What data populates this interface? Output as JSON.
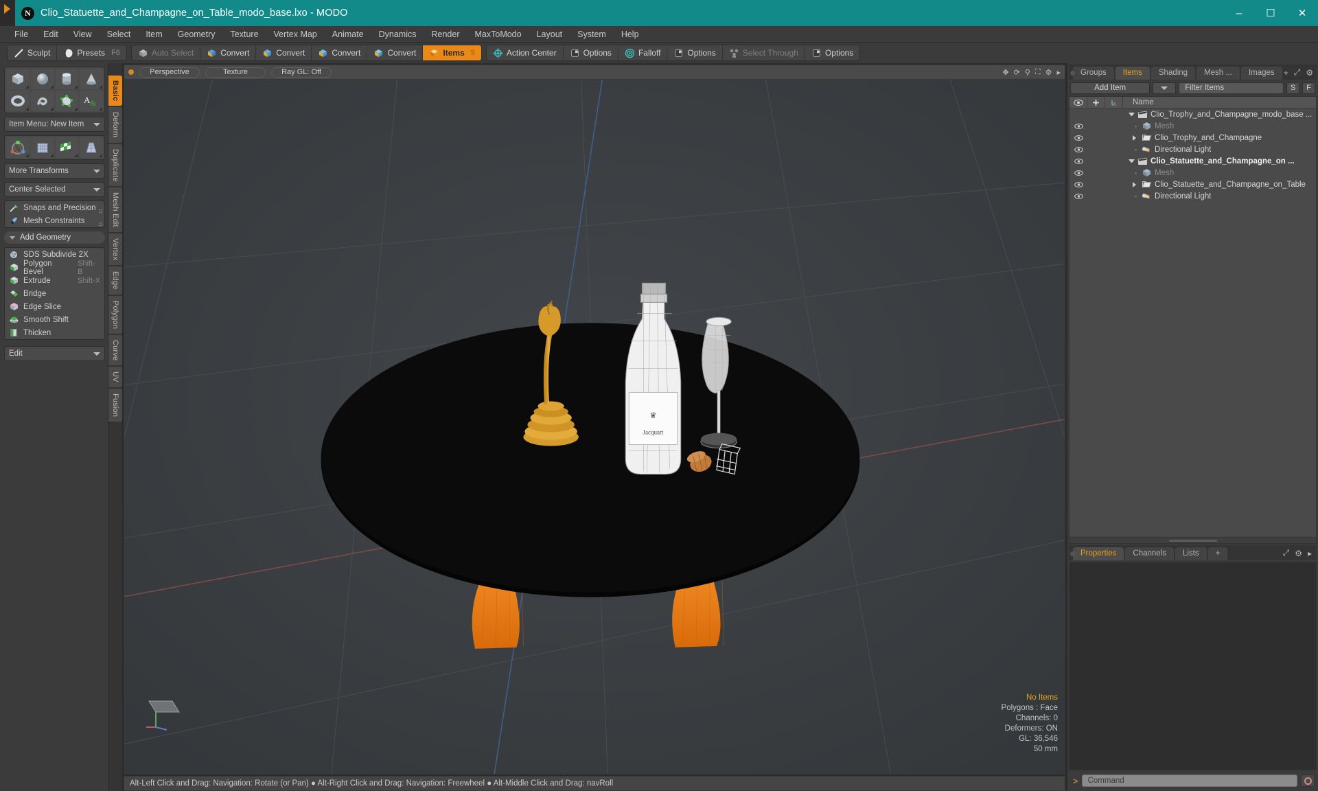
{
  "window": {
    "title": "Clio_Statuette_and_Champagne_on_Table_modo_base.lxo - MODO",
    "app_icon": "modo-logo-icon",
    "minimize": "–",
    "maximize": "☐",
    "close": "✕",
    "titlebar_color": "#128a8a"
  },
  "menubar": {
    "items": [
      "File",
      "Edit",
      "View",
      "Select",
      "Item",
      "Geometry",
      "Texture",
      "Vertex Map",
      "Animate",
      "Dynamics",
      "Render",
      "MaxToModo",
      "Layout",
      "System",
      "Help"
    ]
  },
  "modebar": {
    "groups": [
      {
        "buttons": [
          {
            "label": "Sculpt",
            "icon": "sculpt-pen-icon",
            "state": "normal",
            "shortcut": ""
          },
          {
            "label": "Presets",
            "icon": "presets-sphere-icon",
            "state": "normal",
            "shortcut": "F6"
          }
        ]
      },
      {
        "buttons": [
          {
            "label": "Auto Select",
            "icon": "cube-grey-icon",
            "state": "disabled",
            "shortcut": ""
          },
          {
            "label": "Convert",
            "icon": "convert-vertex-icon",
            "state": "normal",
            "shortcut": ""
          },
          {
            "label": "Convert",
            "icon": "convert-edge-icon",
            "state": "normal",
            "shortcut": ""
          },
          {
            "label": "Convert",
            "icon": "convert-polygon-icon",
            "state": "normal",
            "shortcut": ""
          },
          {
            "label": "Convert",
            "icon": "convert-material-icon",
            "state": "normal",
            "shortcut": ""
          },
          {
            "label": "Items",
            "icon": "items-cube-icon",
            "state": "active",
            "shortcut": "5"
          }
        ]
      },
      {
        "buttons": [
          {
            "label": "Action Center",
            "icon": "action-center-icon",
            "state": "normal",
            "shortcut": ""
          },
          {
            "label": "Options",
            "icon": "options-box-icon",
            "state": "normal",
            "shortcut": ""
          },
          {
            "label": "Falloff",
            "icon": "falloff-target-icon",
            "state": "normal",
            "shortcut": ""
          },
          {
            "label": "Options",
            "icon": "options-box-icon",
            "state": "normal",
            "shortcut": ""
          },
          {
            "label": "Select Through",
            "icon": "select-through-icon",
            "state": "disabled",
            "shortcut": ""
          },
          {
            "label": "Options",
            "icon": "options-box-icon",
            "state": "normal",
            "shortcut": ""
          }
        ]
      }
    ]
  },
  "left_panel": {
    "primitive_tiles": [
      {
        "icon": "cube-primitive-icon"
      },
      {
        "icon": "sphere-primitive-icon"
      },
      {
        "icon": "cylinder-primitive-icon"
      },
      {
        "icon": "cone-primitive-icon"
      },
      {
        "icon": "torus-primitive-icon"
      },
      {
        "icon": "tube-primitive-icon"
      },
      {
        "icon": "polygon-pen-icon"
      },
      {
        "icon": "text-tool-icon"
      }
    ],
    "item_menu": {
      "label": "Item Menu: New Item"
    },
    "transform_tiles": [
      {
        "icon": "transform-gizmo-icon"
      },
      {
        "icon": "bend-grid-icon"
      },
      {
        "icon": "checker-plane-icon"
      },
      {
        "icon": "taper-grid-icon"
      }
    ],
    "more_transforms": {
      "label": "More Transforms"
    },
    "center_selected": {
      "label": "Center Selected"
    },
    "snaps_rows": [
      {
        "label": "Snaps and Precision",
        "icon": "snap-arrow-icon"
      },
      {
        "label": "Mesh Constraints",
        "icon": "mesh-constraint-icon"
      }
    ],
    "add_geometry_header": "Add Geometry",
    "geometry_rows": [
      {
        "label": "SDS Subdivide 2X",
        "icon": "sds-subdivide-icon",
        "shortcut": ""
      },
      {
        "label": "Polygon Bevel",
        "icon": "polygon-bevel-icon",
        "shortcut": "Shift-B"
      },
      {
        "label": "Extrude",
        "icon": "extrude-icon",
        "shortcut": "Shift-X"
      },
      {
        "label": "Bridge",
        "icon": "bridge-icon",
        "shortcut": ""
      },
      {
        "label": "Edge Slice",
        "icon": "edge-slice-icon",
        "shortcut": ""
      },
      {
        "label": "Smooth Shift",
        "icon": "smooth-shift-icon",
        "shortcut": ""
      },
      {
        "label": "Thicken",
        "icon": "thicken-icon",
        "shortcut": ""
      }
    ],
    "edit_dropdown": {
      "label": "Edit"
    }
  },
  "vertical_tabs": {
    "items": [
      {
        "label": "Basic",
        "active": true
      },
      {
        "label": "Deform",
        "active": false
      },
      {
        "label": "Duplicate",
        "active": false
      },
      {
        "label": "Mesh Edit",
        "active": false
      },
      {
        "label": "Vertex",
        "active": false
      },
      {
        "label": "Edge",
        "active": false
      },
      {
        "label": "Polygon",
        "active": false
      },
      {
        "label": "Curve",
        "active": false
      },
      {
        "label": "UV",
        "active": false
      },
      {
        "label": "Fusion",
        "active": false
      }
    ]
  },
  "viewport": {
    "header_buttons": [
      "Perspective",
      "Texture",
      "Ray GL: Off"
    ],
    "header_icons": [
      "move-view-icon",
      "rotate-view-icon",
      "zoom-view-icon",
      "fit-view-icon",
      "gear-icon",
      "chevron-right-icon"
    ],
    "stats": {
      "selection": "No Items",
      "polygons": "Polygons : Face",
      "channels": "Channels: 0",
      "deformers": "Deformers: ON",
      "gl": "GL: 36,546",
      "scale": "50 mm"
    },
    "axis_labels": [
      "x",
      "y",
      "z"
    ],
    "scene_description": "black elliptical table with orange legs holding a gold trophy statuette, a wireframe champagne bottle, a champagne flute, a cork and a wire cage"
  },
  "statusbar": {
    "text": "Alt-Left Click and Drag: Navigation: Rotate (or Pan) ● Alt-Right Click and Drag: Navigation: Freewheel ● Alt-Middle Click and Drag: navRoll"
  },
  "right_panel": {
    "top_tabs": [
      {
        "label": "Groups",
        "active": false
      },
      {
        "label": "Items",
        "active": true
      },
      {
        "label": "Shading",
        "active": false
      },
      {
        "label": "Mesh ...",
        "active": false
      },
      {
        "label": "Images",
        "active": false
      }
    ],
    "top_tab_icons": [
      "plus-icon",
      "expand-icon",
      "gear-icon",
      "chevron-right-icon"
    ],
    "add_item": {
      "label": "Add Item",
      "caret_icon": "chevron-down-icon"
    },
    "filter": {
      "placeholder": "Filter Items",
      "value": ""
    },
    "filter_buttons": [
      "S",
      "F"
    ],
    "tree_header": {
      "eye": "eye-icon",
      "lock": "lock-icon",
      "axis": "axis-icon",
      "name": "Name"
    },
    "tree_rows": [
      {
        "label": "Clio_Trophy_and_Champagne_modo_base ...",
        "icon": "scene-clapper-icon",
        "indent": 0,
        "toggle": "down",
        "eye": false,
        "dim": false,
        "bold": false
      },
      {
        "label": "Mesh",
        "icon": "mesh-cube-icon",
        "indent": 1,
        "toggle": "leaf",
        "eye": true,
        "dim": true,
        "bold": false
      },
      {
        "label": "Clio_Trophy_and_Champagne",
        "icon": "group-folder-icon",
        "indent": 1,
        "toggle": "right",
        "eye": true,
        "dim": false,
        "bold": false
      },
      {
        "label": "Directional Light",
        "icon": "light-icon",
        "indent": 1,
        "toggle": "leaf",
        "eye": true,
        "dim": false,
        "bold": false
      },
      {
        "label": "Clio_Statuette_and_Champagne_on ...",
        "icon": "scene-clapper-icon",
        "indent": 0,
        "toggle": "down",
        "eye": true,
        "dim": false,
        "bold": true
      },
      {
        "label": "Mesh",
        "icon": "mesh-cube-icon",
        "indent": 1,
        "toggle": "leaf",
        "eye": true,
        "dim": true,
        "bold": false
      },
      {
        "label": "Clio_Statuette_and_Champagne_on_Table",
        "icon": "group-folder-icon",
        "indent": 1,
        "toggle": "right",
        "eye": true,
        "dim": false,
        "bold": false
      },
      {
        "label": "Directional Light",
        "icon": "light-icon",
        "indent": 1,
        "toggle": "leaf",
        "eye": true,
        "dim": false,
        "bold": false
      }
    ],
    "bottom_tabs": [
      {
        "label": "Properties",
        "active": true
      },
      {
        "label": "Channels",
        "active": false
      },
      {
        "label": "Lists",
        "active": false
      },
      {
        "label": "+",
        "active": false
      }
    ],
    "bottom_tab_icons": [
      "expand-icon",
      "gear-icon",
      "chevron-right-icon"
    ]
  },
  "command_bar": {
    "prompt": ">",
    "placeholder": "Command",
    "value": "",
    "record_icon": "record-circle-icon"
  },
  "colors": {
    "accent_orange": "#e8891a",
    "titlebar_teal": "#128a8a",
    "panel_bg": "#3b3b3b",
    "viewport_bg": "#3a3e41",
    "table_black": "#070707",
    "leg_orange": "#ef7f18",
    "trophy_gold": "#d39a28"
  }
}
